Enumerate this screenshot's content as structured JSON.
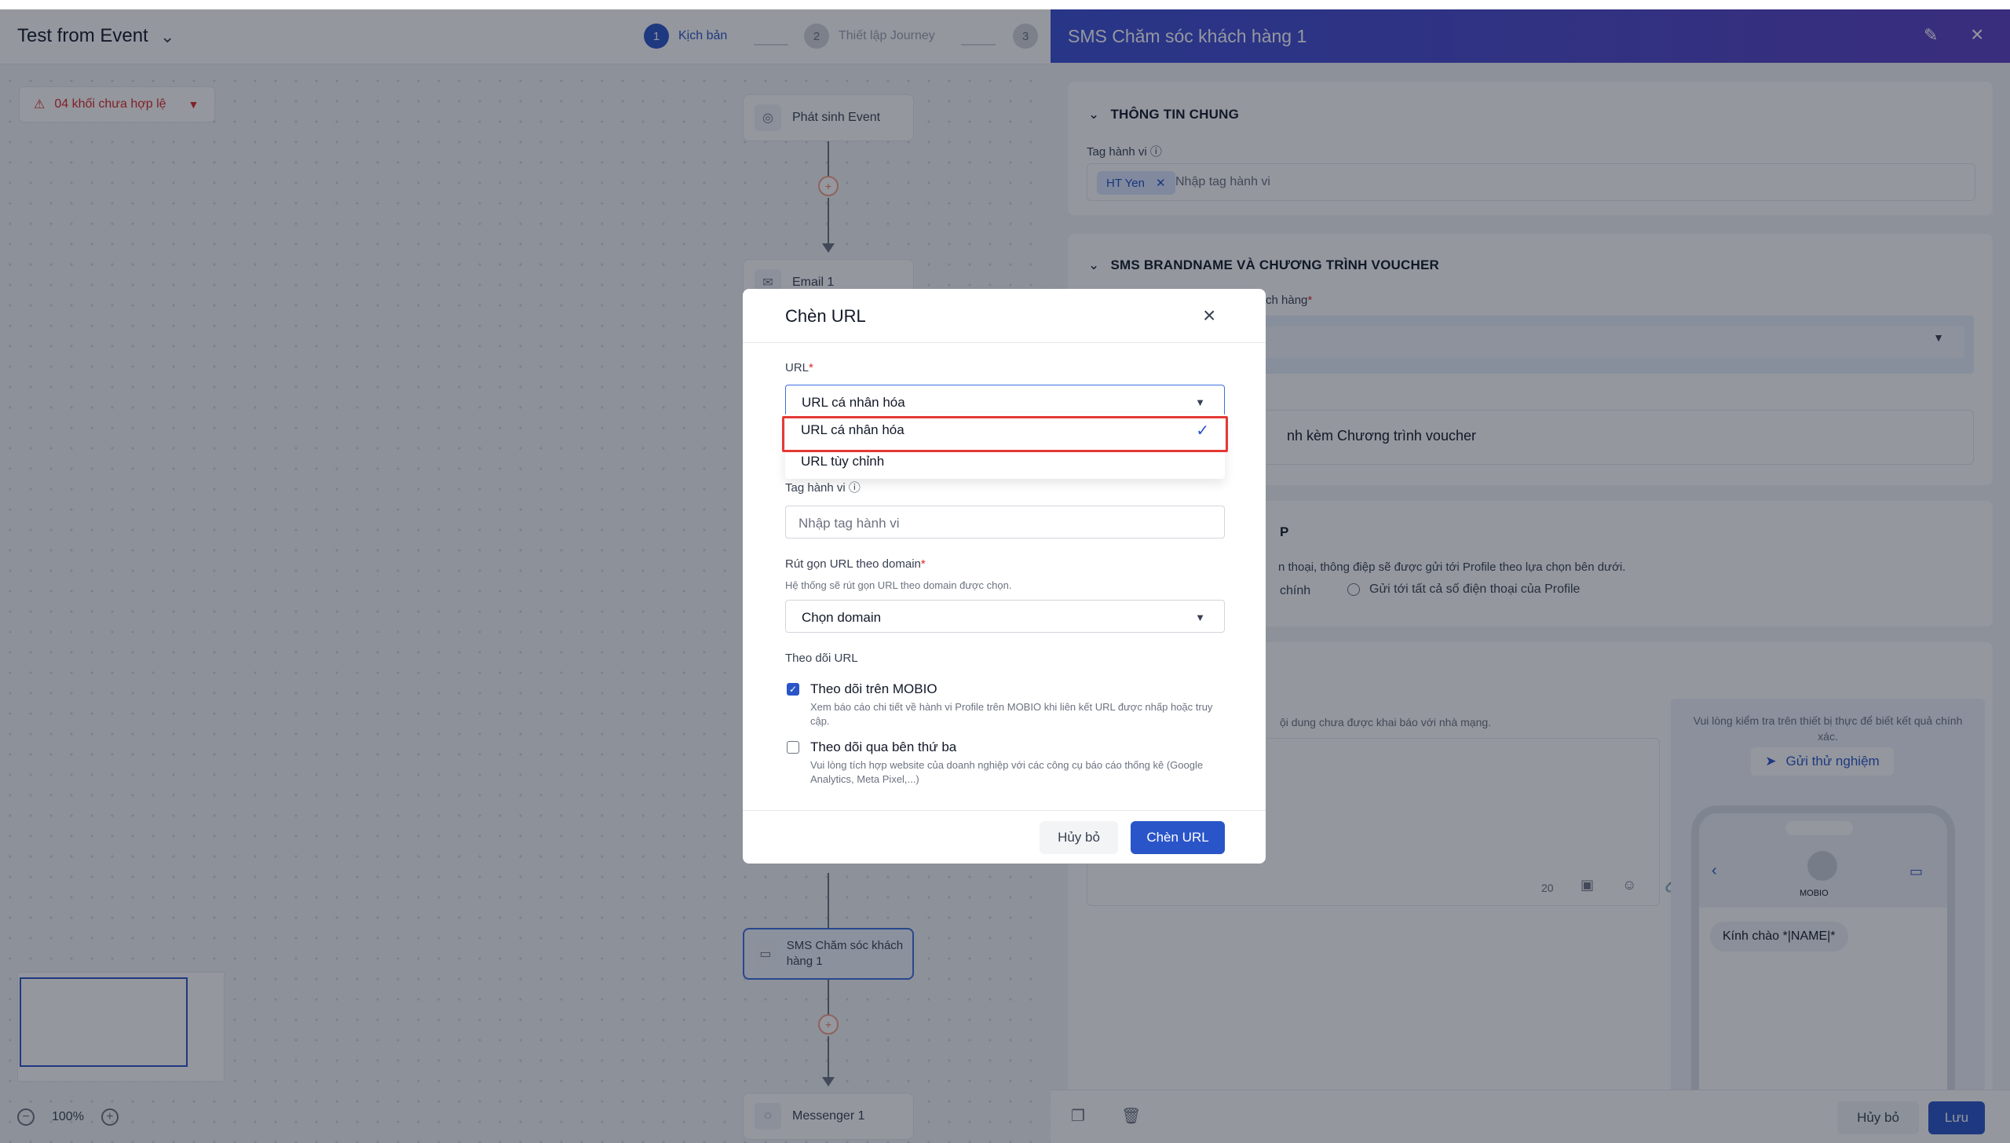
{
  "canvas": {
    "journey_title": "Test from Event",
    "steps": [
      {
        "num": "1",
        "label": "Kịch bản"
      },
      {
        "num": "2",
        "label": "Thiết lập Journey"
      },
      {
        "num": "3",
        "label": ""
      }
    ],
    "warning": "04 khối chưa hợp lệ",
    "nodes": {
      "event": "Phát sinh Event",
      "email": "Email 1",
      "sms": "SMS Chăm sóc khách hàng 1",
      "messenger": "Messenger 1"
    },
    "zoom": "100%"
  },
  "panel": {
    "title": "SMS Chăm sóc khách hàng 1",
    "general_section": "THÔNG TIN CHUNG",
    "tag_label": "Tag hành vi",
    "tag_chip": "HT Yen",
    "tag_placeholder": "Nhập tag hành vi",
    "sms_section": "SMS BRANDNAME VÀ CHƯƠNG TRÌNH VOUCHER",
    "customer_label_partial": "ch hàng",
    "voucher_partial": "nh kèm Chương trình voucher",
    "section3_partial": "P",
    "send_note_partial": "n thoại, thông điệp sẽ được gửi tới Profile theo lựa chọn bên dưới.",
    "radio1_partial": "chính",
    "radio2": "Gửi tới tất cả số điện thoại của Profile",
    "content_note_partial": "ội dung chưa được khai báo với nhà mạng.",
    "counter": "20",
    "preview_note": "Vui lòng kiểm tra trên thiết bị thực để biết kết quả chính xác.",
    "test_send": "Gửi thử nghiệm",
    "phone_name": "MOBIO",
    "phone_message": "Kính chào *|NAME|*",
    "cancel": "Hủy bỏ",
    "save": "Lưu"
  },
  "modal": {
    "title": "Chèn URL",
    "url_label": "URL",
    "url_value": "URL cá nhân hóa",
    "options": [
      "URL cá nhân hóa",
      "URL tùy chỉnh"
    ],
    "tag_label": "Tag hành vi",
    "tag_placeholder": "Nhập tag hành vi",
    "domain_label": "Rút gọn URL theo domain",
    "domain_hint": "Hệ thống sẽ rút gọn URL theo domain được chọn.",
    "domain_value": "Chọn domain",
    "track_label": "Theo dõi URL",
    "track_mobio": "Theo dõi trên MOBIO",
    "track_mobio_desc": "Xem báo cáo chi tiết về hành vi Profile trên MOBIO khi liên kết URL được nhấp hoặc truy cập.",
    "track_third": "Theo dõi qua bên thứ ba",
    "track_third_desc": "Vui lòng tích hợp website của doanh nghiệp với các công cụ báo cáo thống kê (Google Analytics, Meta Pixel,...)",
    "cancel": "Hủy bỏ",
    "insert": "Chèn URL"
  },
  "colors": {
    "primary": "#2a55c9",
    "danger": "#e53935",
    "header_gradient_start": "#3b4fd6",
    "header_gradient_end": "#5b3fc4"
  }
}
